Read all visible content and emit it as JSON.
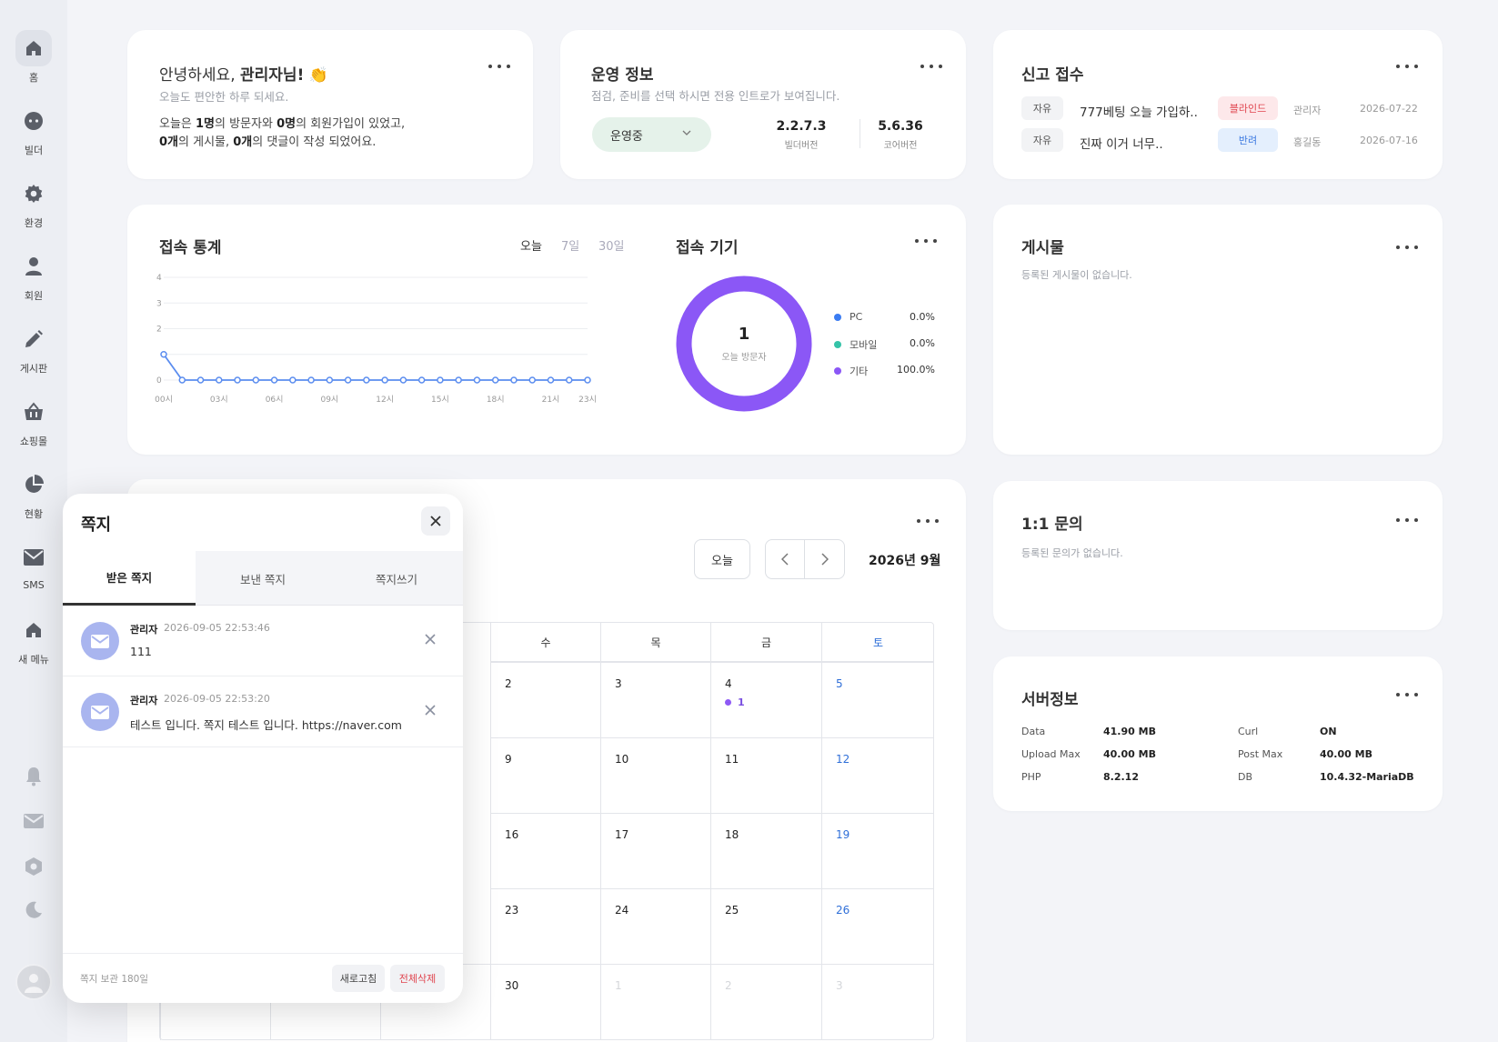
{
  "sidebar": {
    "items": [
      {
        "label": "홈",
        "icon": "home-icon"
      },
      {
        "label": "빌더",
        "icon": "chat-icon"
      },
      {
        "label": "환경",
        "icon": "gear-icon"
      },
      {
        "label": "회원",
        "icon": "user-icon"
      },
      {
        "label": "게시판",
        "icon": "pencil-icon"
      },
      {
        "label": "쇼핑몰",
        "icon": "basket-icon"
      },
      {
        "label": "현황",
        "icon": "pie-chart-icon"
      },
      {
        "label": "SMS",
        "icon": "mail-icon"
      },
      {
        "label": "새 메뉴",
        "icon": "home-icon"
      }
    ],
    "bottom_icons": [
      "bell-icon",
      "mail-icon",
      "settings-icon",
      "moon-icon"
    ]
  },
  "welcome": {
    "greeting": "안녕하세요, ",
    "name": "관리자님!",
    "emoji": "👏",
    "subtitle": "오늘도 편안한 하루 되세요.",
    "line1_prefix": "오늘은 ",
    "visitors": "1명",
    "line1_mid": "의 방문자와 ",
    "signups": "0명",
    "line1_suffix": "의 회원가입이 있었고,",
    "posts": "0개",
    "line2_mid": "의 게시물, ",
    "comments": "0개",
    "line2_suffix": "의 댓글이 작성 되었어요."
  },
  "ops": {
    "title": "운영 정보",
    "subtitle": "점검, 준비를 선택 하시면 전용 인트로가 보여집니다.",
    "status": "운영중",
    "builder_version": "2.2.7.3",
    "builder_version_label": "빌더버전",
    "core_version": "5.6.36",
    "core_version_label": "코어버전"
  },
  "reports": {
    "title": "신고 접수",
    "rows": [
      {
        "category": "자유",
        "title": "777베팅 오늘 가입하..",
        "status": "블라인드",
        "status_color": "red",
        "author": "관리자",
        "date": "2026-07-22"
      },
      {
        "category": "자유",
        "title": "진짜 이거 너무..",
        "status": "반려",
        "status_color": "blue",
        "author": "홍길동",
        "date": "2026-07-16"
      }
    ]
  },
  "stats": {
    "title": "접속 통계",
    "tabs": [
      "오늘",
      "7일",
      "30일"
    ],
    "active_tab": "오늘"
  },
  "chart_data": [
    {
      "type": "line",
      "title": "접속 통계",
      "x": [
        0,
        1,
        2,
        3,
        4,
        5,
        6,
        7,
        8,
        9,
        10,
        11,
        12,
        13,
        14,
        15,
        16,
        17,
        18,
        19,
        20,
        21,
        22,
        23
      ],
      "x_tick_labels": [
        "00시",
        "03시",
        "06시",
        "09시",
        "12시",
        "15시",
        "18시",
        "21시",
        "23시"
      ],
      "x_tick_positions": [
        0,
        3,
        6,
        9,
        12,
        15,
        18,
        21,
        23
      ],
      "series": [
        {
          "values": [
            1,
            0,
            0,
            0,
            0,
            0,
            0,
            0,
            0,
            0,
            0,
            0,
            0,
            0,
            0,
            0,
            0,
            0,
            0,
            0,
            0,
            0,
            0,
            0
          ]
        }
      ],
      "y_ticks": [
        0,
        1,
        2,
        3,
        4
      ],
      "y_tick_labels": [
        "0",
        "",
        "2",
        "3",
        "4"
      ],
      "ylim": [
        0,
        4
      ],
      "grid": true,
      "color": "#5b8def"
    },
    {
      "type": "pie",
      "title": "접속 기기",
      "center_value": "1",
      "center_label": "오늘 방문자",
      "slices": [
        {
          "label": "PC",
          "value": 0.0,
          "display": "0.0%",
          "color": "#3b7cf2"
        },
        {
          "label": "모바일",
          "value": 0.0,
          "display": "0.0%",
          "color": "#35c3a8"
        },
        {
          "label": "기타",
          "value": 100.0,
          "display": "100.0%",
          "color": "#8b57f6"
        }
      ]
    }
  ],
  "posts": {
    "title": "게시물",
    "empty": "등록된 게시물이 없습니다."
  },
  "inquiry": {
    "title": "1:1 문의",
    "empty": "등록된 문의가 없습니다."
  },
  "server": {
    "title": "서버정보",
    "rows": [
      {
        "k1": "Data",
        "v1": "41.90 MB",
        "k2": "Curl",
        "v2": "ON"
      },
      {
        "k1": "Upload Max",
        "v1": "40.00 MB",
        "k2": "Post Max",
        "v2": "40.00 MB"
      },
      {
        "k1": "PHP",
        "v1": "8.2.12",
        "k2": "DB",
        "v2": "10.4.32-MariaDB"
      }
    ]
  },
  "calendar": {
    "today_label": "오늘",
    "month_label": "2026년 9월",
    "headers": [
      "수",
      "목",
      "금",
      "토"
    ],
    "weeks": [
      [
        {
          "d": "2"
        },
        {
          "d": "3"
        },
        {
          "d": "4",
          "event": "1"
        },
        {
          "d": "5"
        }
      ],
      [
        {
          "d": "9"
        },
        {
          "d": "10"
        },
        {
          "d": "11"
        },
        {
          "d": "12"
        }
      ],
      [
        {
          "d": "16"
        },
        {
          "d": "17"
        },
        {
          "d": "18"
        },
        {
          "d": "19"
        }
      ],
      [
        {
          "d": "23"
        },
        {
          "d": "24"
        },
        {
          "d": "25"
        },
        {
          "d": "26"
        }
      ],
      [
        {
          "d": "30"
        },
        {
          "d": "1"
        },
        {
          "d": "2"
        },
        {
          "d": "3"
        }
      ]
    ]
  },
  "messages": {
    "title": "쪽지",
    "tabs": [
      "받은 쪽지",
      "보낸 쪽지",
      "쪽지쓰기"
    ],
    "active_tab": "받은 쪽지",
    "items": [
      {
        "sender": "관리자",
        "time": "2026-09-05 22:53:46",
        "text": "111"
      },
      {
        "sender": "관리자",
        "time": "2026-09-05 22:53:20",
        "text": "테스트 입니다. 쪽지 테스트 입니다. https://naver.com"
      }
    ],
    "retention": "쪽지 보관 180일",
    "refresh_label": "새로고침",
    "delete_all_label": "전체삭제"
  }
}
